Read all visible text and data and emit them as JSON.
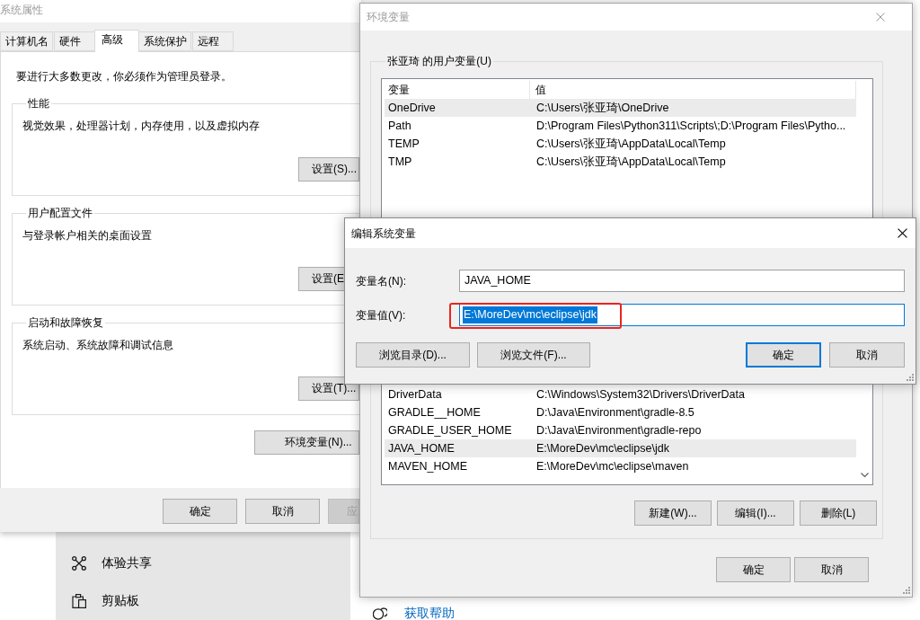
{
  "background_app": {
    "nav_items": [
      {
        "kind": "share",
        "label": "体验共享"
      },
      {
        "kind": "clipboard",
        "label": "剪贴板"
      }
    ],
    "help_link": "获取帮助"
  },
  "system_properties": {
    "title": "系统属性",
    "active": false,
    "tabs": [
      {
        "label": "计算机名",
        "selected": false
      },
      {
        "label": "硬件",
        "selected": false
      },
      {
        "label": "高级",
        "selected": true
      },
      {
        "label": "系统保护",
        "selected": false
      },
      {
        "label": "远程",
        "selected": false
      }
    ],
    "notice": "要进行大多数更改，你必须作为管理员登录。",
    "groups": [
      {
        "title": "性能",
        "description": "视觉效果，处理器计划，内存使用，以及虚拟内存",
        "button": "设置(S)..."
      },
      {
        "title": "用户配置文件",
        "description": "与登录帐户相关的桌面设置",
        "button": "设置(E"
      },
      {
        "title": "启动和故障恢复",
        "description": "系统启动、系统故障和调试信息",
        "button": "设置(T)..."
      }
    ],
    "environment_button": "环境变量(N)...",
    "footer_buttons": [
      {
        "label": "确定",
        "disabled": false
      },
      {
        "label": "取消",
        "disabled": false
      },
      {
        "label": "应",
        "disabled": true
      }
    ]
  },
  "environment_variables": {
    "title": "环境变量",
    "active": false,
    "user_variables": {
      "title": "张亚琦 的用户变量(U)",
      "columns": [
        "变量",
        "值"
      ],
      "rows": [
        {
          "name": "OneDrive",
          "value": "C:\\Users\\张亚琦\\OneDrive",
          "selected": true
        },
        {
          "name": "Path",
          "value": "D:\\Program Files\\Python311\\Scripts\\;D:\\Program Files\\Pytho...",
          "selected": false
        },
        {
          "name": "TEMP",
          "value": "C:\\Users\\张亚琦\\AppData\\Local\\Temp",
          "selected": false
        },
        {
          "name": "TMP",
          "value": "C:\\Users\\张亚琦\\AppData\\Local\\Temp",
          "selected": false
        }
      ]
    },
    "system_variables": {
      "rows": [
        {
          "name": "DriverData",
          "value": "C:\\Windows\\System32\\Drivers\\DriverData",
          "selected": false
        },
        {
          "name": "GRADLE__HOME",
          "value": "D:\\Java\\Environment\\gradle-8.5",
          "selected": false
        },
        {
          "name": "GRADLE_USER_HOME",
          "value": "D:\\Java\\Environment\\gradle-repo",
          "selected": false
        },
        {
          "name": "JAVA_HOME",
          "value": "E:\\MoreDev\\mc\\eclipse\\jdk",
          "selected": true
        },
        {
          "name": "MAVEN_HOME",
          "value": "E:\\MoreDev\\mc\\eclipse\\maven",
          "selected": false
        }
      ]
    },
    "buttons": [
      "新建(W)...",
      "编辑(I)...",
      "删除(L)"
    ],
    "footer_buttons": [
      "确定",
      "取消"
    ]
  },
  "edit_dialog": {
    "title": "编辑系统变量",
    "active": true,
    "fields": [
      {
        "label": "变量名(N):",
        "value": "JAVA_HOME",
        "focused": false,
        "highlighted": false
      },
      {
        "label": "变量值(V):",
        "value": "E:\\MoreDev\\mc\\eclipse\\jdk",
        "focused": true,
        "highlighted": true
      }
    ],
    "browse_buttons": [
      "浏览目录(D)...",
      "浏览文件(F)..."
    ],
    "action_buttons": [
      {
        "label": "确定",
        "default": true
      },
      {
        "label": "取消",
        "default": false
      }
    ]
  }
}
